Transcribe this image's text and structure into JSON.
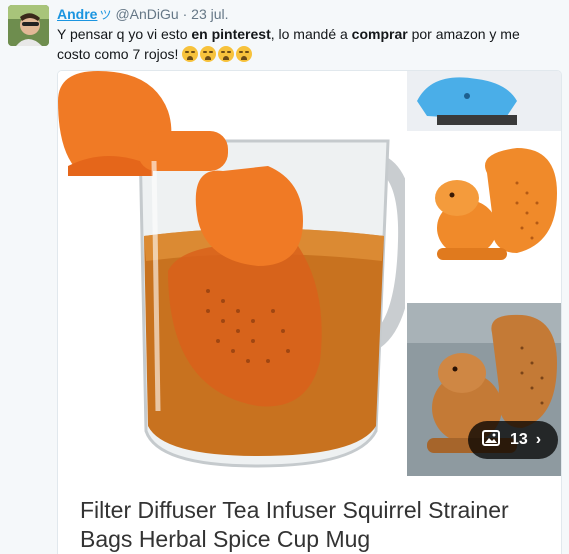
{
  "tweet": {
    "author_name": "Andre",
    "author_badge": "ツ",
    "handle": "@AnDiGu",
    "separator": "·",
    "date": "23 jul.",
    "text_parts": {
      "p1": "Y pensar q yo vi esto ",
      "bold1": "en pinterest",
      "p2": ",  lo mandé a ",
      "bold2": "comprar",
      "p3": " por amazon y me costo como 7 rojos!"
    },
    "emoji_count": 4,
    "emoji_name": "loudly-crying-face"
  },
  "card": {
    "gallery_count": "13",
    "title": "Filter Diffuser Tea Infuser Squirrel Strainer Bags Herbal Spice Cup Mug"
  },
  "colors": {
    "link": "#1b95e0",
    "muted": "#657786",
    "squirrel_orange": "#f08a2a",
    "tea_amber": "#d0771c",
    "blue_squirrel": "#4aaee8"
  }
}
